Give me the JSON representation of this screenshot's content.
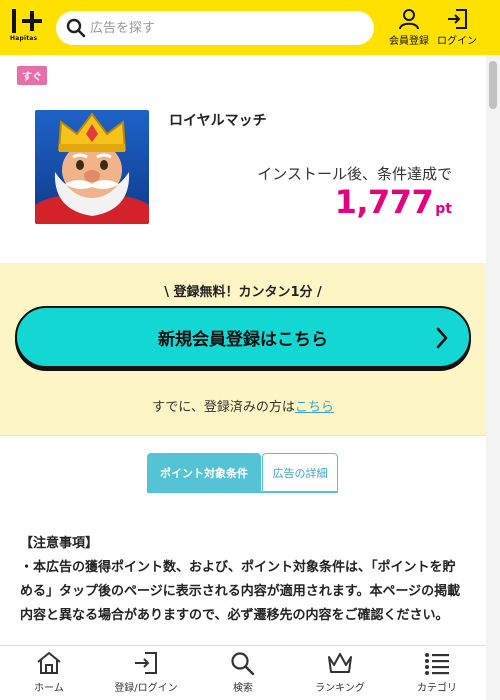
{
  "header": {
    "logo_text": "Hapitas",
    "search_placeholder": "広告を探す",
    "register_label": "会員登録",
    "login_label": "ログイン"
  },
  "offer": {
    "badge": "すぐ",
    "title": "ロイヤルマッチ",
    "condition": "インストール後、条件達成で",
    "points": "1,777",
    "points_unit": "pt"
  },
  "register": {
    "caption": "\\ 登録無料！カンタン1分 /",
    "button_label": "新規会員登録はこちら",
    "already_text": "すでに、登録済みの方は",
    "already_link": "こちら"
  },
  "tabs": [
    {
      "label": "ポイント対象条件",
      "active": true
    },
    {
      "label": "広告の詳細",
      "active": false
    }
  ],
  "notice": {
    "heading": "【注意事項】",
    "body": "・本広告の獲得ポイント数、および、ポイント対象条件は、「ポイントを貯める」タップ後のページに表示される内容が適用されます。本ページの掲載内容と異なる場合がありますので、必ず遷移先の内容をご確認ください。"
  },
  "bottom_nav": [
    {
      "label": "ホーム",
      "icon": "home-icon"
    },
    {
      "label": "登録/ログイン",
      "icon": "login-icon"
    },
    {
      "label": "検索",
      "icon": "search-icon"
    },
    {
      "label": "ランキング",
      "icon": "crown-icon"
    },
    {
      "label": "カテゴリ",
      "icon": "list-icon"
    }
  ],
  "colors": {
    "header_bg": "#ffe100",
    "points": "#e5007f",
    "badge": "#e86ea8",
    "cta": "#12d7d2",
    "tab_active": "#55c3d6",
    "register_panel": "#fdf5c4"
  }
}
